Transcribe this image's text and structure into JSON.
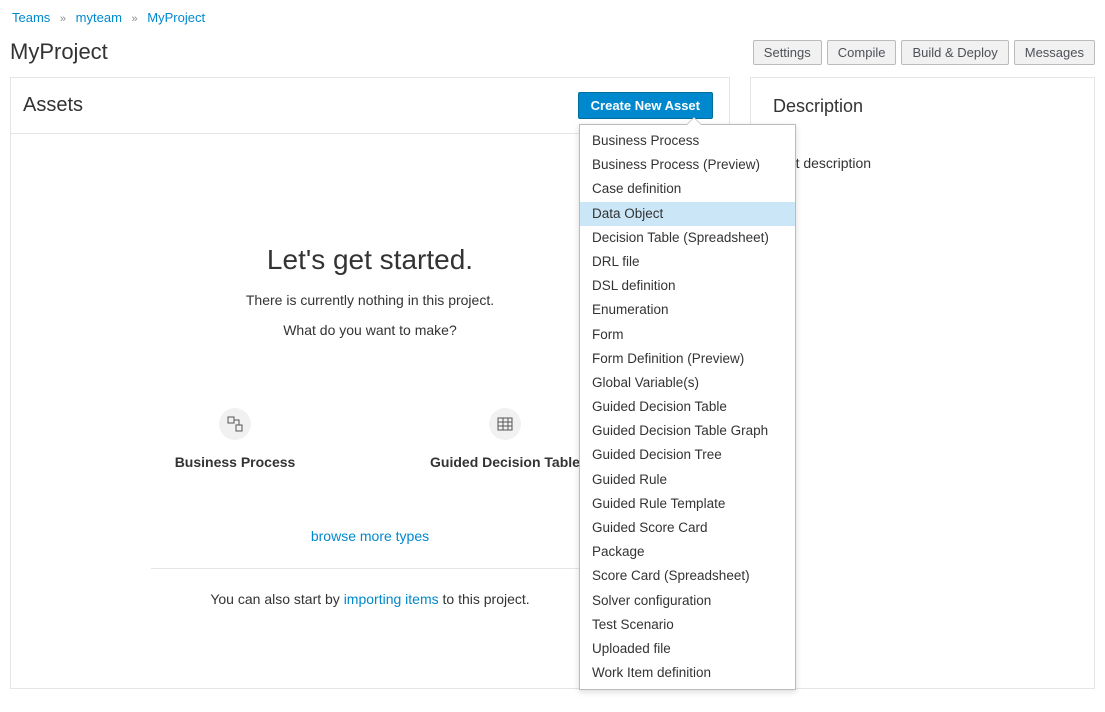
{
  "breadcrumb": {
    "items": [
      "Teams",
      "myteam",
      "MyProject"
    ]
  },
  "page_title": "MyProject",
  "top_buttons": {
    "settings": "Settings",
    "compile": "Compile",
    "build_deploy": "Build & Deploy",
    "messages": "Messages"
  },
  "assets": {
    "title": "Assets",
    "create_button": "Create New Asset",
    "empty_title": "Let's get started.",
    "empty_sub": "There is currently nothing in this project.",
    "empty_question": "What do you want to make?",
    "quick": [
      {
        "label": "Business Process"
      },
      {
        "label": "Guided Decision Table"
      }
    ],
    "browse_more": "browse more types",
    "import_prefix": "You can also start by ",
    "import_link": "importing items",
    "import_suffix": " to this project."
  },
  "dropdown": {
    "items": [
      "Business Process",
      "Business Process (Preview)",
      "Case definition",
      "Data Object",
      "Decision Table (Spreadsheet)",
      "DRL file",
      "DSL definition",
      "Enumeration",
      "Form",
      "Form Definition (Preview)",
      "Global Variable(s)",
      "Guided Decision Table",
      "Guided Decision Table Graph",
      "Guided Decision Tree",
      "Guided Rule",
      "Guided Rule Template",
      "Guided Score Card",
      "Package",
      "Score Card (Spreadsheet)",
      "Solver configuration",
      "Test Scenario",
      "Uploaded file",
      "Work Item definition"
    ],
    "highlighted_index": 3
  },
  "description": {
    "title": "Description",
    "text": "fault description"
  }
}
